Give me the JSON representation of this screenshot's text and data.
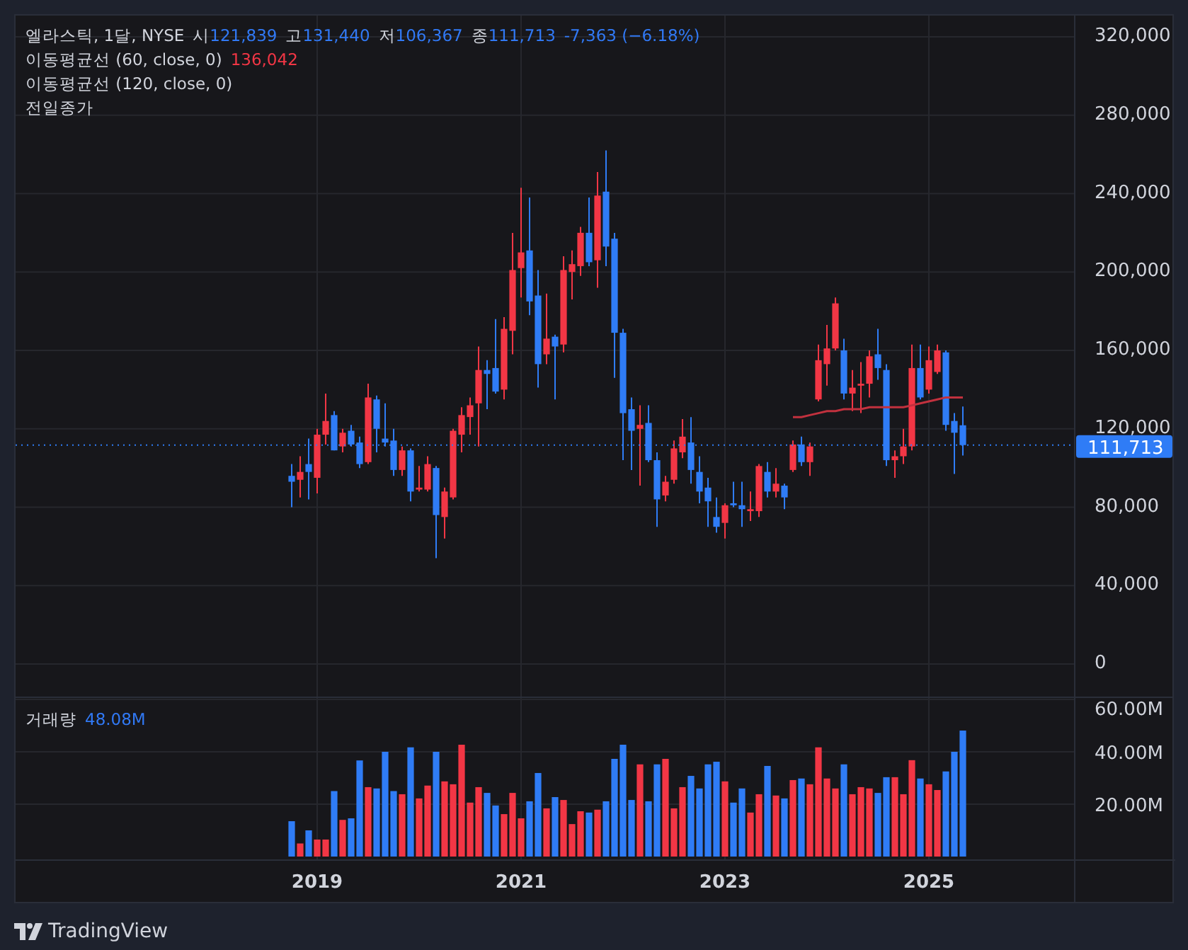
{
  "legend": {
    "symbol": "엘라스틱, 1달, NYSE",
    "ohlc": [
      {
        "label": "시",
        "value": "121,839"
      },
      {
        "label": "고",
        "value": "131,440"
      },
      {
        "label": "저",
        "value": "106,367"
      },
      {
        "label": "종",
        "value": "111,713"
      }
    ],
    "change": "-7,363 (−6.18%)"
  },
  "indicators": [
    {
      "label": "이동평균선 (60, close, 0)",
      "value": "136,042"
    },
    {
      "label": "이동평균선 (120, close, 0)"
    },
    {
      "label": "전일종가"
    }
  ],
  "price_axis": {
    "labels": [
      "320,000",
      "280,000",
      "240,000",
      "200,000",
      "160,000",
      "120,000",
      "80,000",
      "40,000",
      "0"
    ],
    "last_price": "111,713"
  },
  "volume": {
    "label": "거래량",
    "value": "48.08M",
    "axis_labels": [
      "60.00M",
      "40.00M",
      "20.00M"
    ]
  },
  "time_axis": {
    "labels": [
      "2019",
      "2021",
      "2023",
      "2025"
    ]
  },
  "footer": {
    "brand": "TradingView"
  }
}
